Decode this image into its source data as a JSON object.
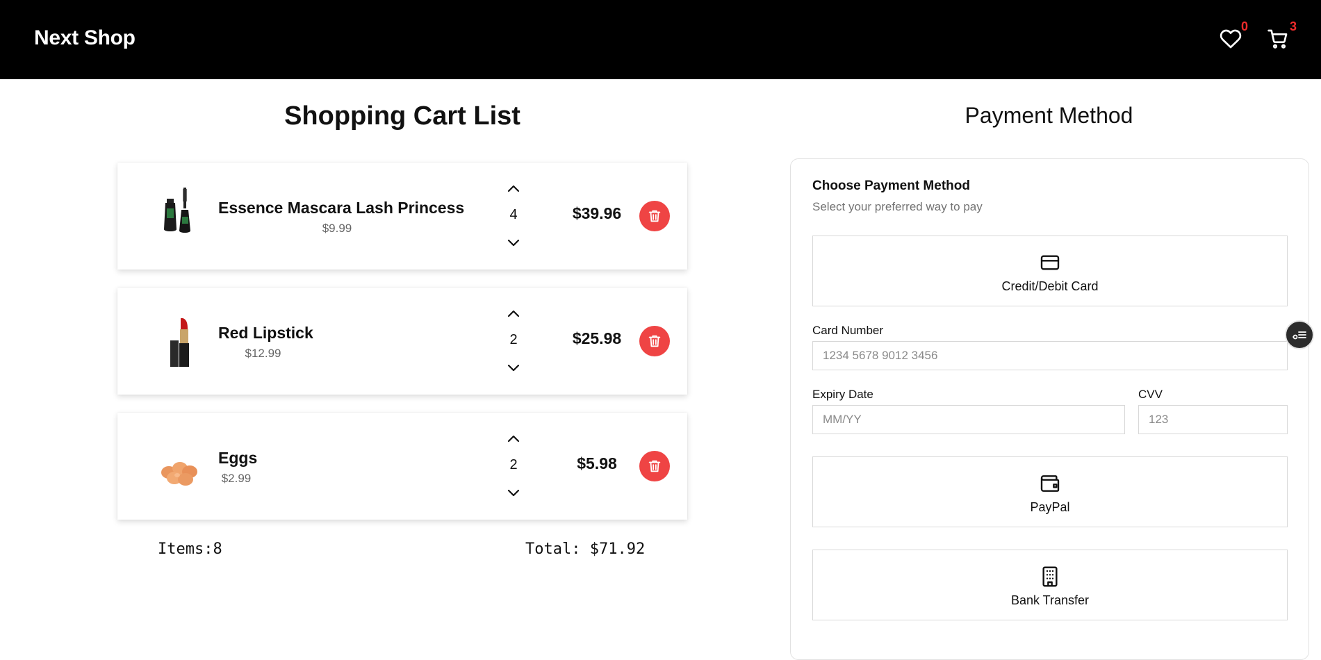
{
  "header": {
    "brand": "Next Shop",
    "wishlist_count": "0",
    "cart_count": "3",
    "badge_color": "#ef2b2b"
  },
  "cart": {
    "title": "Shopping Cart List",
    "items": [
      {
        "name": "Essence Mascara Lash Princess",
        "price": "$9.99",
        "quantity": "4",
        "subtotal": "$39.96",
        "image": "mascara"
      },
      {
        "name": "Red Lipstick",
        "price": "$12.99",
        "quantity": "2",
        "subtotal": "$25.98",
        "image": "lipstick"
      },
      {
        "name": "Eggs",
        "price": "$2.99",
        "quantity": "2",
        "subtotal": "$5.98",
        "image": "eggs"
      }
    ],
    "summary": {
      "items_text": "Items:8",
      "total_text": "Total: $71.92"
    },
    "delete_color": "#ef4444"
  },
  "payment": {
    "title": "Payment Method",
    "card_title": "Choose Payment Method",
    "card_subtitle": "Select your preferred way to pay",
    "methods": [
      {
        "label": "Credit/Debit Card",
        "icon": "credit-card-icon"
      },
      {
        "label": "PayPal",
        "icon": "wallet-icon"
      },
      {
        "label": "Bank Transfer",
        "icon": "building-icon"
      }
    ],
    "fields": {
      "card_number": {
        "label": "Card Number",
        "placeholder": "1234 5678 9012 3456"
      },
      "expiry": {
        "label": "Expiry Date",
        "placeholder": "MM/YY"
      },
      "cvv": {
        "label": "CVV",
        "placeholder": "123"
      }
    }
  }
}
